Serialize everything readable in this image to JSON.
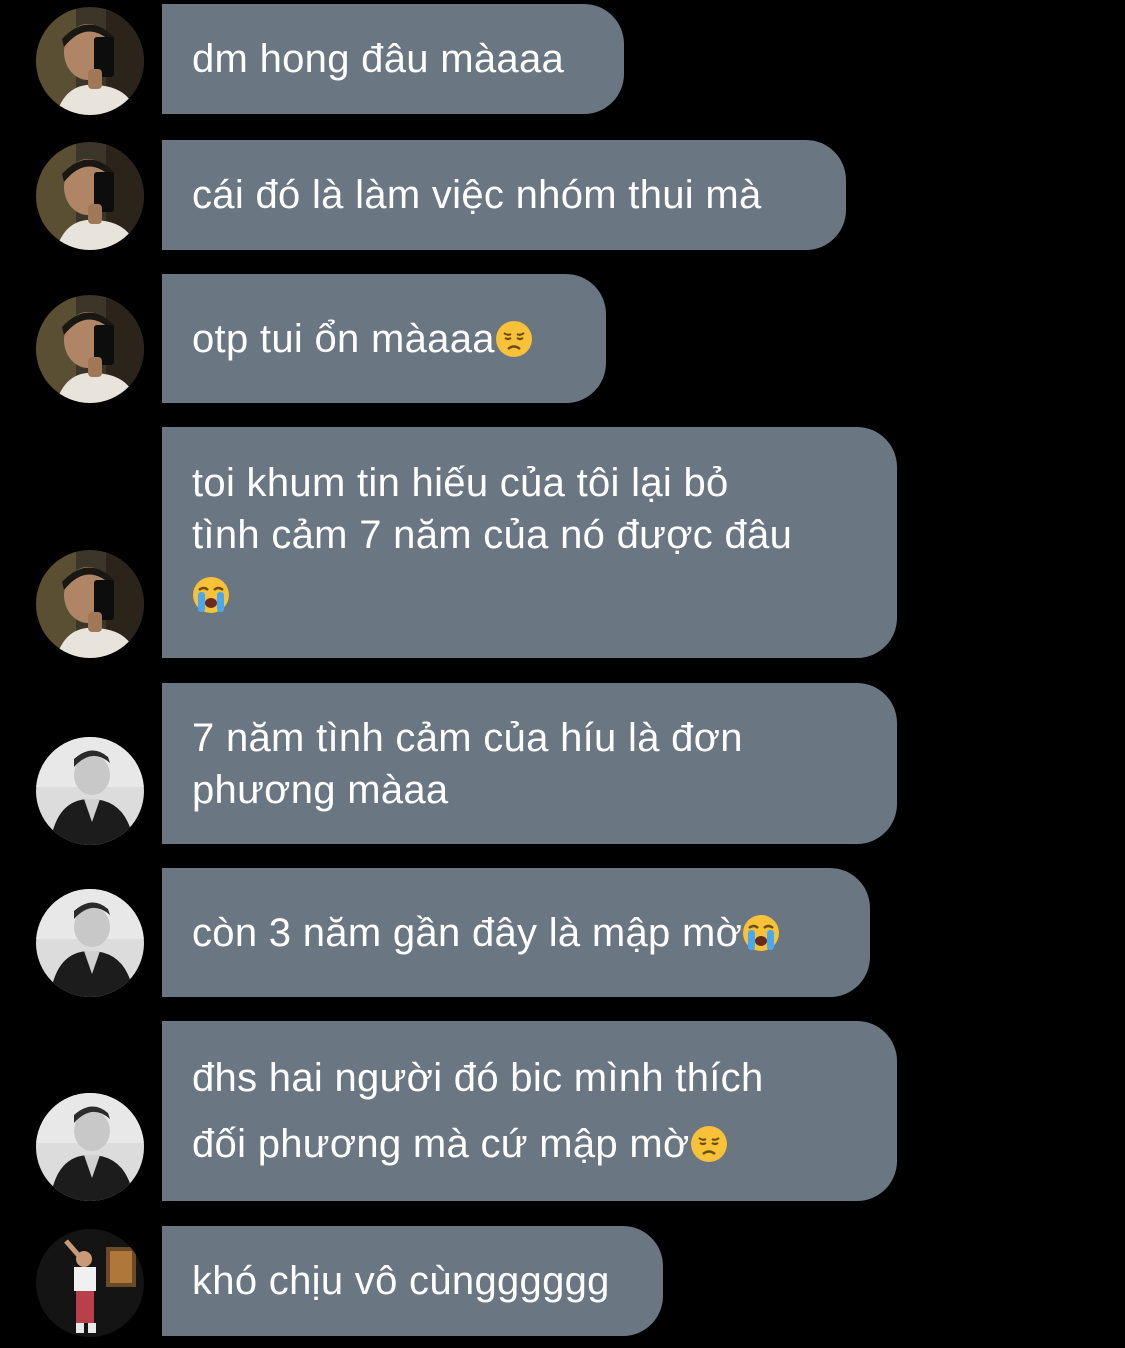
{
  "messages": [
    {
      "sender": "user-a",
      "lines": [
        "dm hong đâu màaaa"
      ],
      "emoji": ""
    },
    {
      "sender": "user-a",
      "lines": [
        "cái đó là làm việc nhóm thui mà"
      ],
      "emoji": ""
    },
    {
      "sender": "user-a",
      "lines": [
        "otp tui ổn màaaa"
      ],
      "emoji": "disappointed-face"
    },
    {
      "sender": "user-a",
      "lines": [
        "toi khum tin hiếu của tôi lại bỏ",
        "tình cảm 7 năm của nó được đâu",
        ""
      ],
      "emoji": "loudly-crying-face"
    },
    {
      "sender": "user-b",
      "lines": [
        "7 năm tình cảm của híu là đơn",
        "phương màaa"
      ],
      "emoji": ""
    },
    {
      "sender": "user-b",
      "lines": [
        "còn 3 năm gần đây là mập mờ"
      ],
      "emoji": "loudly-crying-face"
    },
    {
      "sender": "user-b",
      "lines": [
        "đhs hai người đó bic mình thích",
        "đối phương mà cứ mập mờ"
      ],
      "emoji": "disappointed-face"
    },
    {
      "sender": "user-c",
      "lines": [
        "khó chịu vô cùngggggg"
      ],
      "emoji": ""
    }
  ],
  "colors": {
    "background": "#000000",
    "bubble": "#6b7683",
    "text": "#ffffff"
  }
}
